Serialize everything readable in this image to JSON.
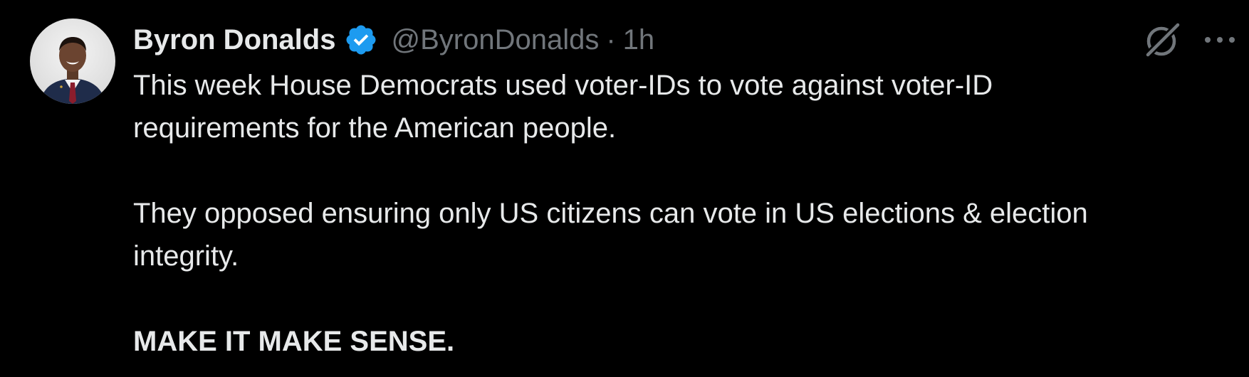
{
  "author": {
    "display_name": "Byron Donalds",
    "handle": "@ByronDonalds",
    "separator": "·",
    "time": "1h",
    "verified": true
  },
  "tweet": {
    "line1": "This week House Democrats used voter-IDs to vote against voter-ID",
    "line2": "requirements for the American people.",
    "line3": "They opposed ensuring only US citizens can vote in US elections & election",
    "line4": "integrity.",
    "line5": "MAKE IT MAKE SENSE."
  },
  "icons": {
    "verified_badge": "verified-badge-icon",
    "grok": "grok-icon",
    "more": "more-icon"
  },
  "colors": {
    "background": "#000000",
    "text_primary": "#e7e9ea",
    "text_secondary": "#71767b",
    "verified_blue": "#1d9bf0"
  }
}
